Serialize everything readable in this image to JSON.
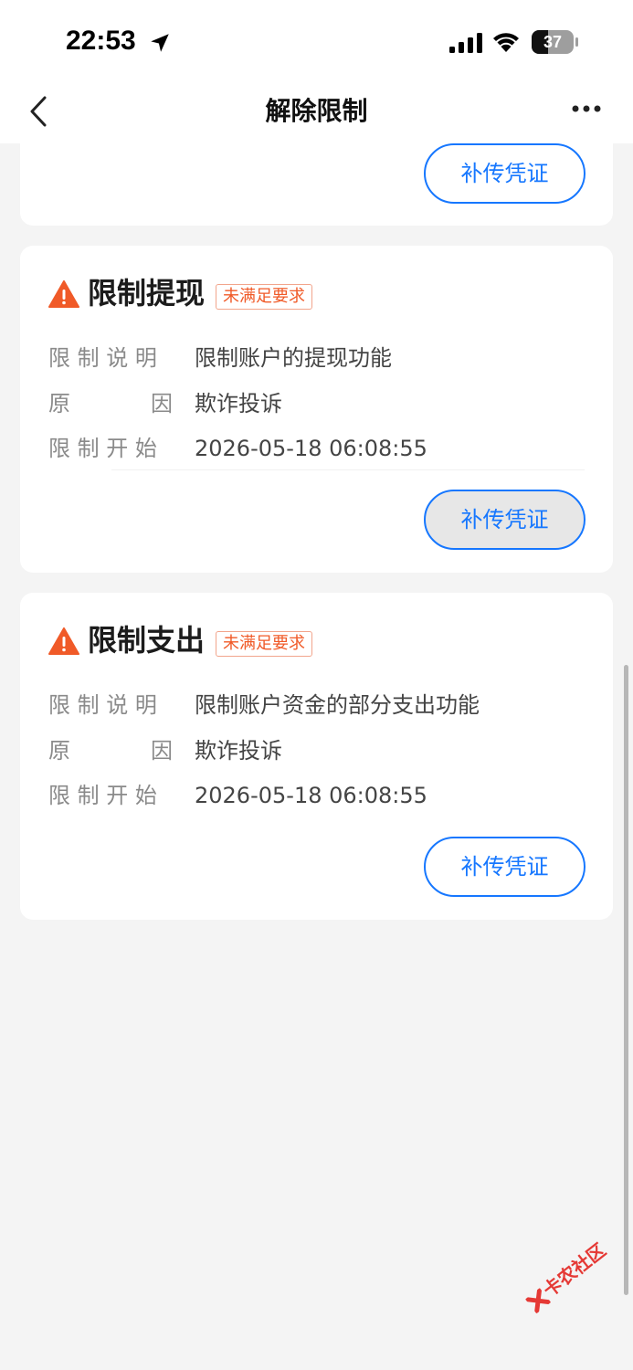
{
  "status_bar": {
    "time": "22:53",
    "battery": "37",
    "icons": [
      "location-arrow-icon",
      "signal-icon",
      "wifi-icon",
      "battery-icon"
    ]
  },
  "nav": {
    "title": "解除限制",
    "icons": [
      "back-chevron-icon",
      "more-icon"
    ]
  },
  "top_card": {
    "button": "补传凭证"
  },
  "cards": [
    {
      "title": "限制提现",
      "badge": "未满足要求",
      "desc_label": "限 制 说 明",
      "desc_value": "限制账户的提现功能",
      "reason_label_1": "原",
      "reason_label_2": "因",
      "reason_value": "欺诈投诉",
      "start_label": "限 制 开 始",
      "start_value": "2026-05-18 06:08:55",
      "button": "补传凭证"
    },
    {
      "title": "限制支出",
      "badge": "未满足要求",
      "desc_label": "限 制 说 明",
      "desc_value": "限制账户资金的部分支出功能",
      "reason_label_1": "原",
      "reason_label_2": "因",
      "reason_value": "欺诈投诉",
      "start_label": "限 制 开 始",
      "start_value": "2026-05-18 06:08:55",
      "button": "补传凭证"
    }
  ],
  "watermark": "卡农社区",
  "colors": {
    "accent": "#1677ff",
    "warning": "#f05a28",
    "background": "#f4f4f4"
  }
}
